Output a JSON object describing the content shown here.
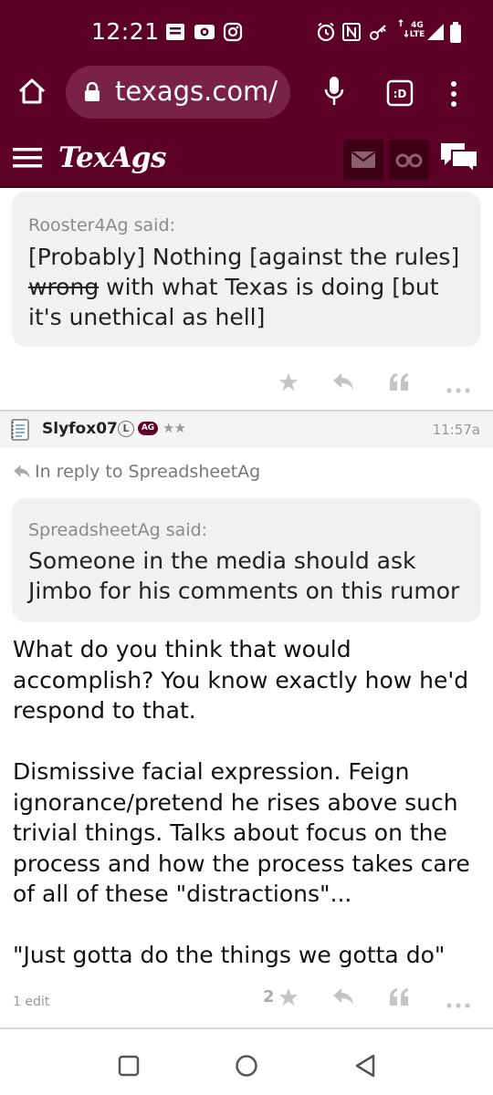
{
  "status_bar": {
    "time": "12:21",
    "network_label": "4G LTE"
  },
  "browser": {
    "url": "texags.com/",
    "icons": [
      "home-icon",
      "lock-icon",
      "microphone-icon",
      "tab-switcher-icon",
      "overflow-menu-icon"
    ]
  },
  "site_header": {
    "logo": "TexAgs",
    "icons": [
      "hamburger-menu-icon",
      "mail-icon",
      "binoculars-icon",
      "chat-bubbles-icon"
    ]
  },
  "posts": [
    {
      "quote": {
        "author_line": "Rooster4Ag said:",
        "text_before_strike": "[Probably] Nothing [against the rules] ",
        "strikethrough_text": "wrong",
        "text_after_strike": " with what Texas is doing [but it's unethical as hell]"
      },
      "actions": [
        "star-icon",
        "reply-icon",
        "quote-icon",
        "more-icon"
      ]
    },
    {
      "username": "Slyfox07",
      "badge_l": "L",
      "badge_ag": "AG",
      "stars": "★★",
      "time": "11:57a",
      "reply_to": "In reply to SpreadsheetAg",
      "quote": {
        "author_line": "SpreadsheetAg said:",
        "text": "Someone in the media should ask Jimbo for his comments on this rumor"
      },
      "paragraphs": [
        "What do you think that would accomplish? You know exactly how he'd respond to that.",
        "Dismissive facial expression. Feign ignorance/pretend he rises above such trivial things. Talks about focus on the process and how the process takes care of all of these \"distractions\"...",
        "\"Just gotta do the things we gotta do\""
      ],
      "edit_note": "1 edit",
      "star_count": "2",
      "actions": [
        "star-icon",
        "reply-icon",
        "quote-icon",
        "more-icon"
      ]
    }
  ],
  "nav_bar": {
    "icons": [
      "recent-apps-icon",
      "home-circle-icon",
      "back-icon"
    ]
  }
}
